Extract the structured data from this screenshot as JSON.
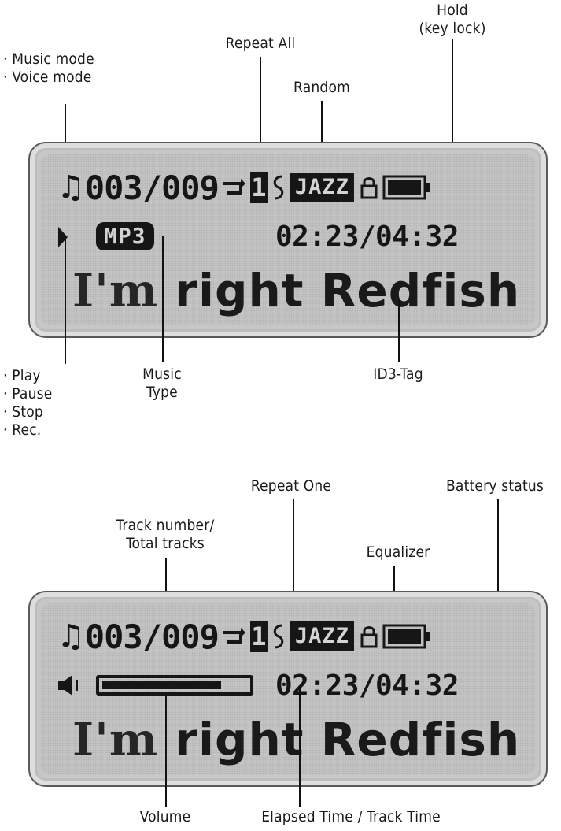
{
  "labels": {
    "music_mode": "Music mode",
    "voice_mode": "Voice mode",
    "repeat_all": "Repeat All",
    "random": "Random",
    "hold_line1": "Hold",
    "hold_line2": "(key lock)",
    "play": "Play",
    "pause": "Pause",
    "stop": "Stop",
    "rec": "Rec.",
    "music_type_line1": "Music",
    "music_type_line2": "Type",
    "id3_tag": "ID3-Tag",
    "repeat_one": "Repeat One",
    "battery_status": "Battery status",
    "track_number_line1": "Track number/",
    "track_number_line2": "Total tracks",
    "equalizer": "Equalizer",
    "volume": "Volume",
    "elapsed_time": "Elapsed Time / Track Time"
  },
  "display": {
    "track": "003/009",
    "repeat_one_digit": "1",
    "equalizer_preset": "JAZZ",
    "music_type": "MP3",
    "time": "02:23/04:32",
    "title_part1": "I'm",
    "title_part2": "right",
    "title_part3": "Redfish",
    "volume_level": 0.82
  },
  "icons": {
    "mode": "music-note-icon",
    "repeat": "repeat-icon",
    "random": "random-icon",
    "lock": "lock-icon",
    "battery": "battery-icon",
    "play": "play-icon",
    "speaker": "speaker-icon"
  },
  "colors": {
    "lcd_background": "#c4c4c4",
    "lcd_ink": "#161616"
  }
}
